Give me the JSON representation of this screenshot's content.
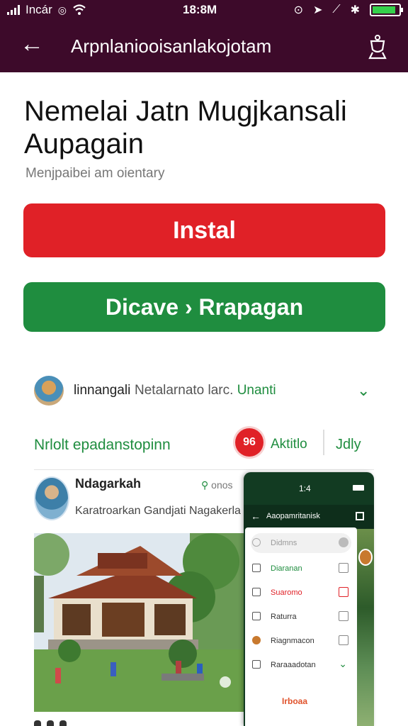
{
  "status_bar": {
    "carrier": "Incár",
    "time": "18:8M",
    "battery_level": 0.9,
    "colors": {
      "background": "#3d0a2a",
      "battery": "#35d14b"
    }
  },
  "app_bar": {
    "back_icon": "arrow-left-icon",
    "title": "Arpnlaniooisanlakojotam",
    "trophy_icon": "trophy-icon"
  },
  "main": {
    "heading": "Nemelai Jatn Mugjkansali Aupagain",
    "subheading": "Menjpaibei am oientary",
    "install_label": "Instal",
    "discover_label": "Dicave › Rrapagan",
    "colors": {
      "install": "#e02127",
      "discover": "#1f8d3f"
    }
  },
  "info_row": {
    "name": "linnangali",
    "description": "Netalarnato larc.",
    "description_accent": "Unanti",
    "chevron_icon": "chevron-down-icon"
  },
  "action_row": {
    "label": "Nrlolt epadanstopinn",
    "badge": "96",
    "middle": "Aktitlo",
    "right": "Jdly"
  },
  "post": {
    "author": "Ndagarkah",
    "meta_icon": "pin-icon",
    "meta": "onos",
    "subtitle": "Karatroarkan Gandjati Nagakerla",
    "image_alt": "traditional-pavilion-photo"
  },
  "overlay": {
    "time": "1:4",
    "title": "Aaopamritanisk",
    "items": [
      {
        "label": "Didmns",
        "icon": "search-icon"
      },
      {
        "label": "Diaranan",
        "icon": "bookmark-icon"
      },
      {
        "label": "Suaromo",
        "icon": "calendar-icon"
      },
      {
        "label": "Raturra",
        "icon": "list-icon"
      },
      {
        "label": "Riagnmacon",
        "icon": "avatar-icon"
      },
      {
        "label": "Raraaadotan",
        "icon": "checkbox-icon"
      }
    ],
    "footer": "Irboaa"
  }
}
